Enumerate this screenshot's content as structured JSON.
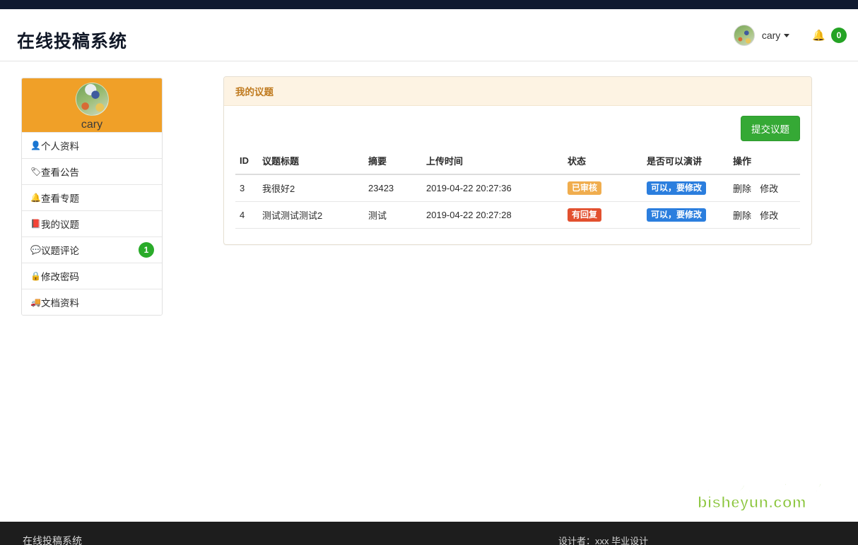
{
  "brand": {
    "title": "在线投稿系统"
  },
  "navbar": {
    "username": "cary",
    "avatar_icon": "user-avatar-photo",
    "caret_icon": "chevron-down-icon",
    "bell_icon": "bell-icon",
    "bell_count": "0"
  },
  "sidebar": {
    "profile": {
      "name": "cary",
      "avatar_icon": "user-avatar-photo"
    },
    "items": [
      {
        "label": "个人资料",
        "icon": "user-icon",
        "glyph": "👤",
        "badge": ""
      },
      {
        "label": "查看公告",
        "icon": "tag-icon",
        "glyph": "🏷",
        "badge": ""
      },
      {
        "label": "查看专题",
        "icon": "bell-icon",
        "glyph": "🔔",
        "badge": ""
      },
      {
        "label": "我的议题",
        "icon": "book-icon",
        "glyph": "📕",
        "badge": ""
      },
      {
        "label": "议题评论",
        "icon": "comment-icon",
        "glyph": "💬",
        "badge": "1"
      },
      {
        "label": "修改密码",
        "icon": "lock-icon",
        "glyph": "🔒",
        "badge": ""
      },
      {
        "label": "文档资料",
        "icon": "truck-icon",
        "glyph": "🚚",
        "badge": ""
      }
    ]
  },
  "panel": {
    "title": "我的议题",
    "submit_button": "提交议题",
    "columns": [
      "ID",
      "议题标题",
      "摘要",
      "上传时间",
      "状态",
      "是否可以演讲",
      "操作"
    ],
    "rows": [
      {
        "id": "3",
        "title": "我很好2",
        "summary": "23423",
        "uploaded_at": "2019-04-22 20:27:36",
        "status": "已审核",
        "status_style": "warning",
        "can_speak": "可以，要修改",
        "ops": {
          "delete": "删除",
          "edit": "修改"
        }
      },
      {
        "id": "4",
        "title": "测试测试测试2",
        "summary": "测试",
        "uploaded_at": "2019-04-22 20:27:28",
        "status": "有回复",
        "status_style": "danger",
        "can_speak": "可以，要修改",
        "ops": {
          "delete": "删除",
          "edit": "修改"
        }
      }
    ]
  },
  "watermark": {
    "line1": "更多设计请关注（毕设云）",
    "line2": "bisheyun.com"
  },
  "footer": {
    "left": "在线投稿系统",
    "right": "设计者：xxx    毕业设计"
  },
  "colors": {
    "topbar": "#101a30",
    "sidebar_header": "#f0a028",
    "panel_header_bg": "#fdf3e3",
    "panel_header_text": "#c07b20",
    "submit_green": "#35a935",
    "badge_green": "#25a325",
    "label_warning": "#f0ad4e",
    "label_danger": "#e2502f",
    "label_info": "#2b7ede",
    "watermark_green": "#8cc63e",
    "footer_bg": "#1d1d1d"
  }
}
